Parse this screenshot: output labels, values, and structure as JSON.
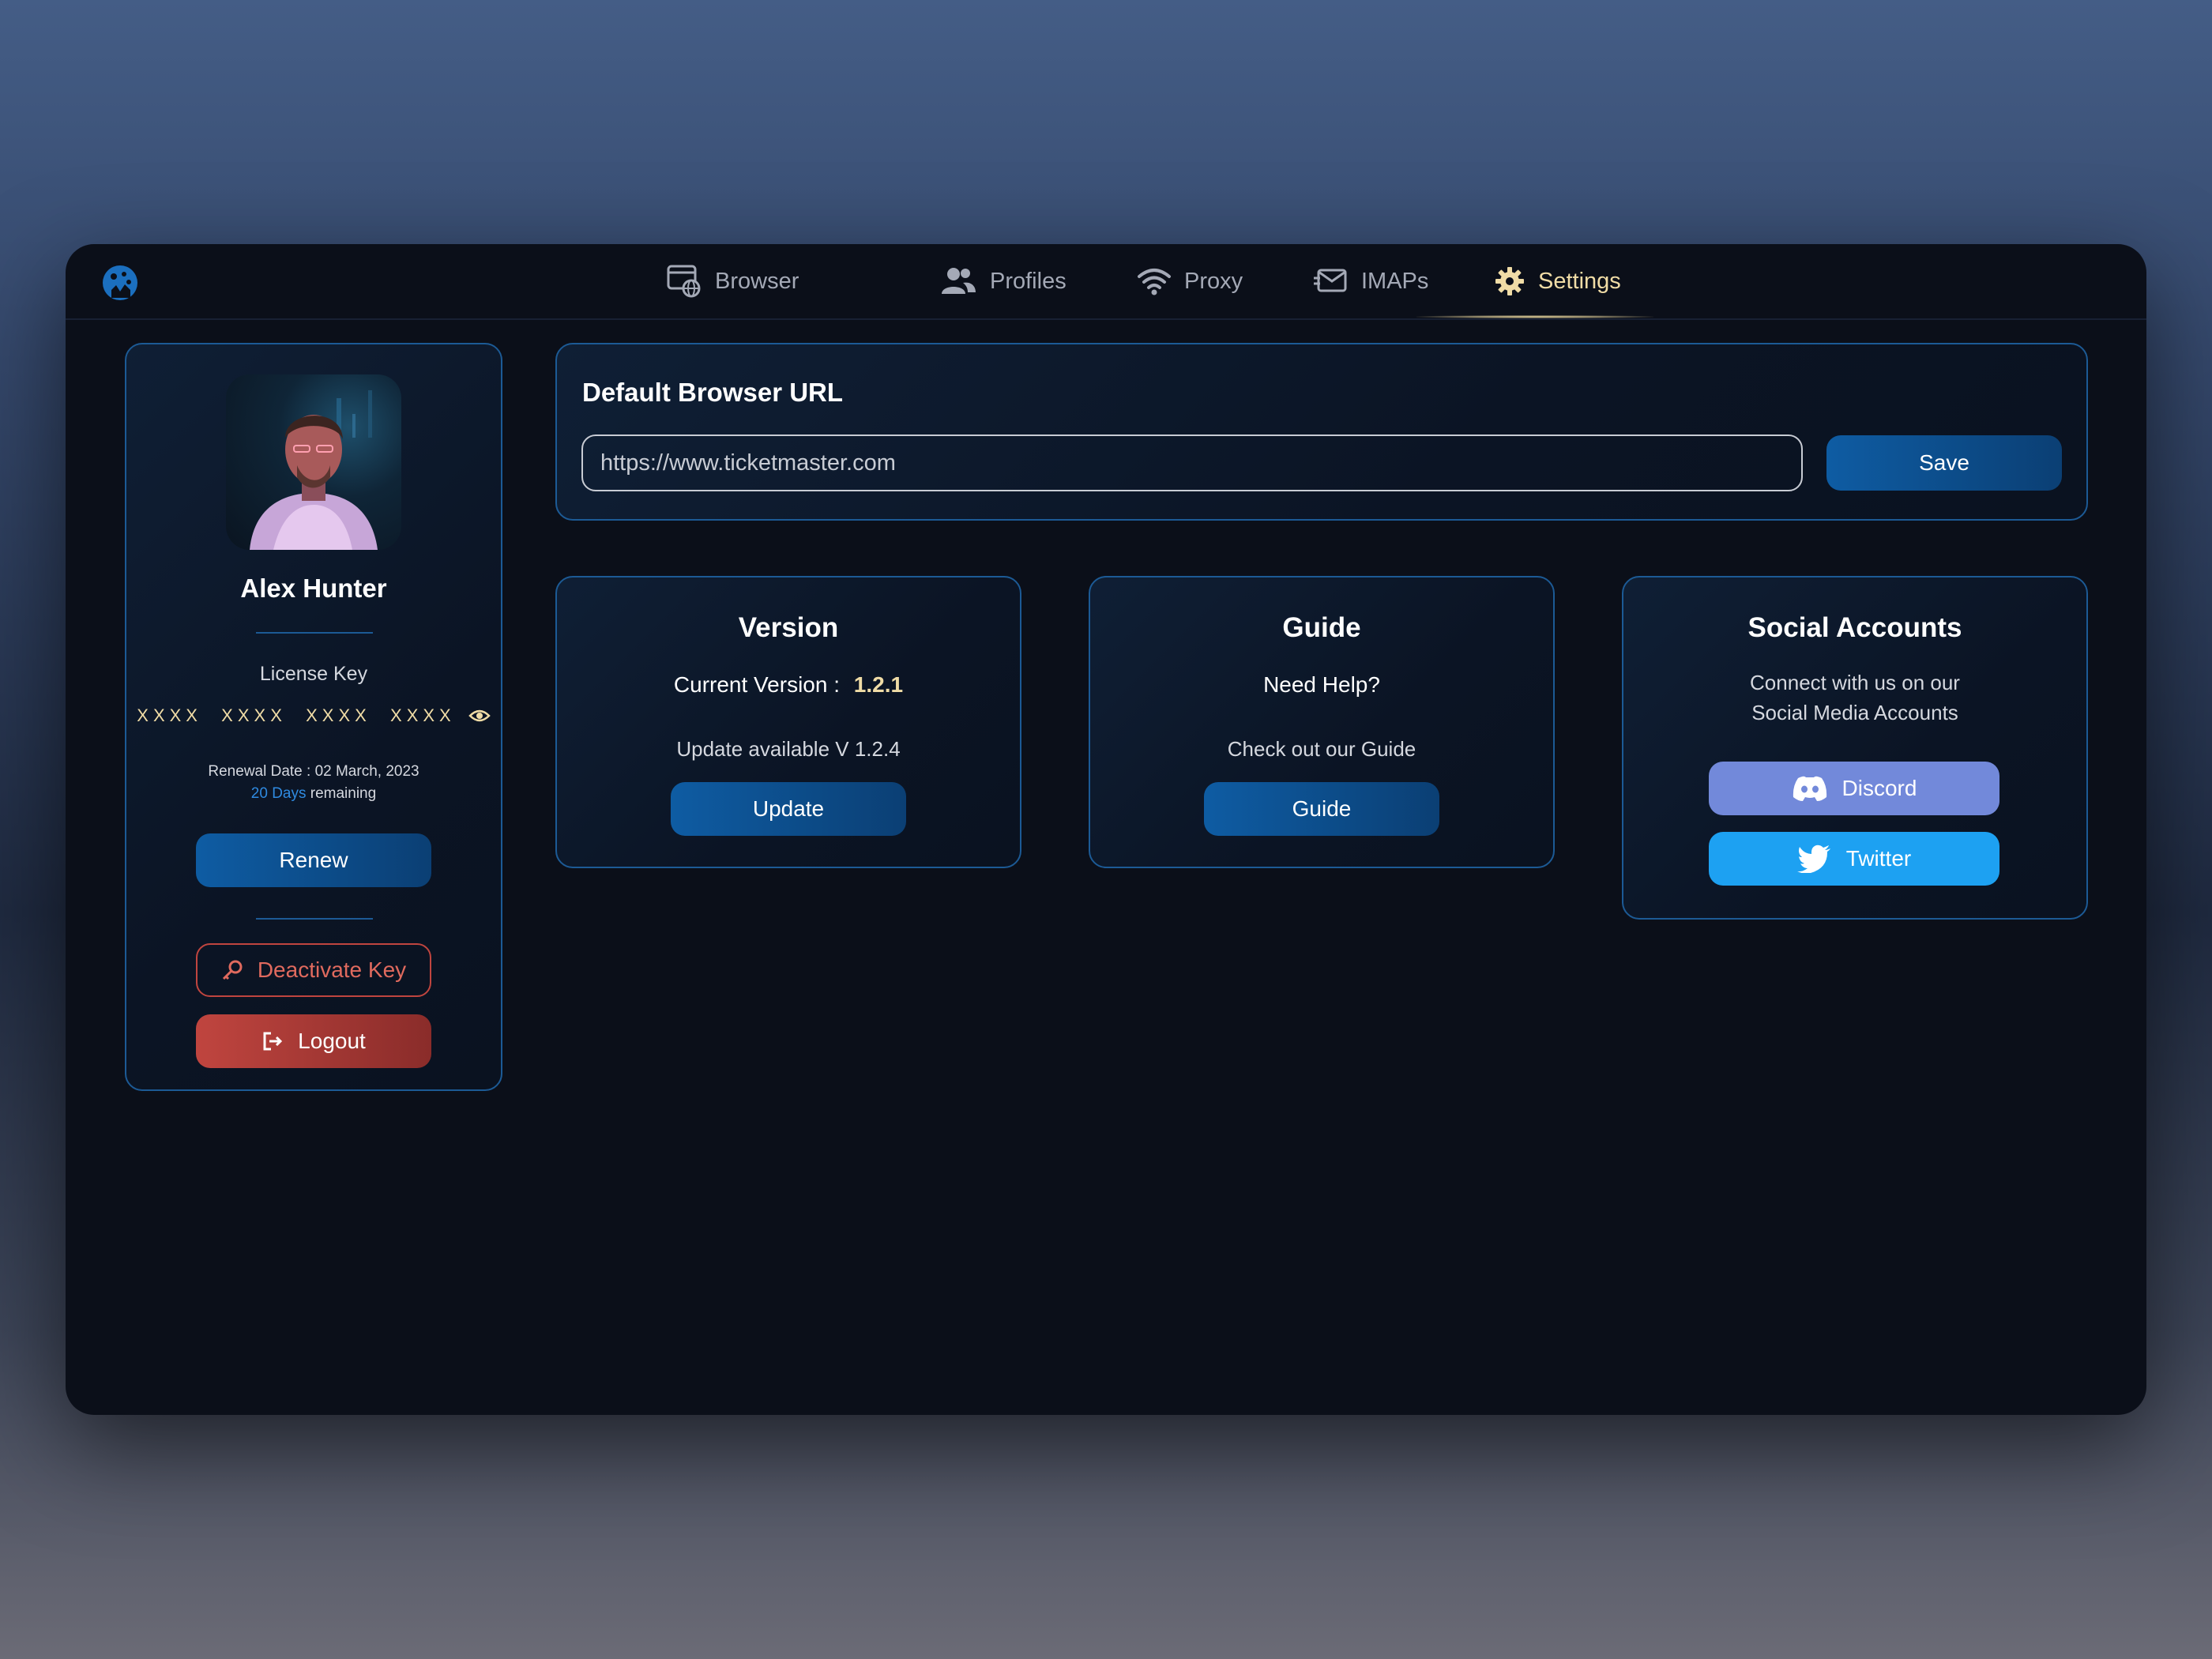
{
  "nav": {
    "items": [
      {
        "label": "Browser",
        "icon": "browser-globe-icon"
      },
      {
        "label": "Profiles",
        "icon": "users-icon"
      },
      {
        "label": "Proxy",
        "icon": "wifi-icon"
      },
      {
        "label": "IMAPs",
        "icon": "mail-check-icon"
      },
      {
        "label": "Settings",
        "icon": "gear-icon"
      }
    ],
    "active": "Settings",
    "logo_icon": "app-logo-icon"
  },
  "profile": {
    "name": "Alex Hunter",
    "license_label": "License Key",
    "license_key": "XXXX  XXXX  XXXX  XXXX",
    "renewal_text": "Renewal Date : 02 March, 2023",
    "days_highlight": "20 Days",
    "days_suffix": " remaining",
    "renew_label": "Renew",
    "deactivate_label": "Deactivate Key",
    "logout_label": "Logout"
  },
  "browser_url": {
    "title": "Default Browser URL",
    "value": "https://www.ticketmaster.com",
    "save_label": "Save"
  },
  "version": {
    "title": "Version",
    "current_label": "Current Version :",
    "current_value": "1.2.1",
    "update_text": "Update available V 1.2.4",
    "button_label": "Update"
  },
  "guide": {
    "title": "Guide",
    "subtitle": "Need Help?",
    "text": "Check out our Guide",
    "button_label": "Guide"
  },
  "social": {
    "title": "Social Accounts",
    "text_line1": "Connect with us on our",
    "text_line2": "Social Media Accounts",
    "discord_label": "Discord",
    "twitter_label": "Twitter"
  },
  "colors": {
    "accent_blue": "#0e5ca3",
    "active_gold": "#f0dca6",
    "discord": "#7289da",
    "twitter": "#1da1f2",
    "danger": "#c0453f"
  }
}
